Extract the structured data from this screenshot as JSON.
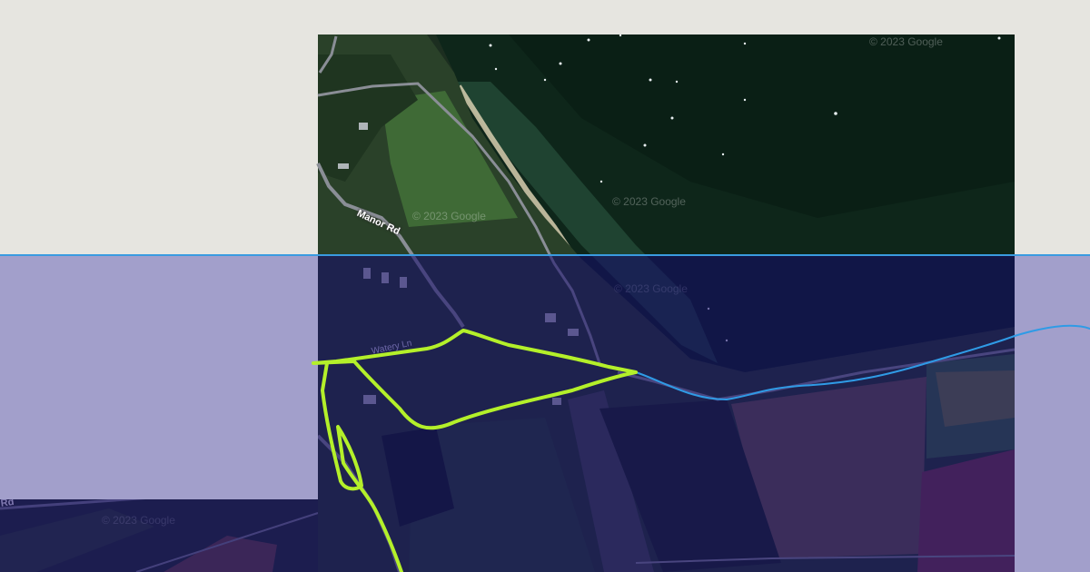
{
  "map": {
    "road_labels": {
      "manor_rd": "Manor Rd",
      "rd": "Rd",
      "watery_ln": "Watery Ln"
    },
    "watermark": "© 2023 Google",
    "colors": {
      "background": "#e6e5e0",
      "overlay": "#a29fcb",
      "divider_line": "#3a9be0",
      "route_primary": "#b4f02a",
      "route_secondary": "#2f9be6",
      "sea": "#0f2a1c",
      "field": "#2f4a2c",
      "road": "#8a8e96"
    }
  }
}
